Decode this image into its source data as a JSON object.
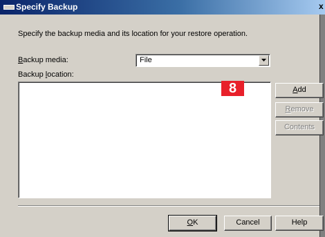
{
  "window": {
    "title": "Specify Backup",
    "close_glyph": "x"
  },
  "description": "Specify the backup media and its location for your restore operation.",
  "backup_media": {
    "label_prefix": "B",
    "label_rest": "ackup media:",
    "selected": "File"
  },
  "backup_location": {
    "label_prefix": "Backup ",
    "label_accel": "l",
    "label_rest": "ocation:",
    "items": []
  },
  "badge": "8",
  "buttons": {
    "add_accel": "A",
    "add_rest": "dd",
    "remove_accel": "R",
    "remove_rest": "emove",
    "contents": "Contents",
    "ok_accel": "O",
    "ok_rest": "K",
    "cancel": "Cancel",
    "help": "Help"
  },
  "colors": {
    "badge_bg": "#e8202a",
    "titlebar": "#0a246a",
    "dialog_bg": "#d4d0c8"
  }
}
